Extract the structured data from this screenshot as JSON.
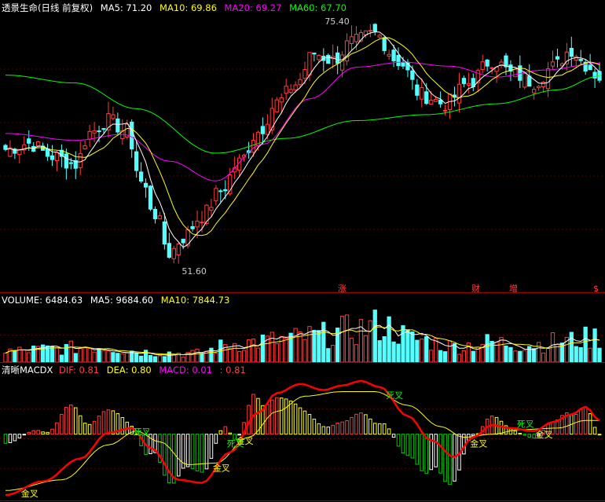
{
  "main": {
    "title": "透景生命(日线 前复权)",
    "ma5_label": "MA5: 71.20",
    "ma10_label": "MA10: 69.86",
    "ma20_label": "MA20: 69.27",
    "ma60_label": "MA60: 67.70",
    "high_label": "75.40",
    "low_label": "51.60",
    "event_markers": [
      "涨",
      "财",
      "增",
      "$"
    ]
  },
  "volume": {
    "label": "VOLUME: 6484.63",
    "ma5_label": "MA5: 9684.60",
    "ma10_label": "MA10: 7844.73"
  },
  "macd": {
    "name": "清晰MACDX",
    "dif_label": "DIF: 0.81",
    "dea_label": "DEA: 0.80",
    "macd_label": "MACD: 0.01",
    "extra_label": ": 0.81",
    "cross_labels": [
      "金叉",
      "死叉",
      "金叉",
      "死叉",
      "金叉",
      "死叉",
      "金叉",
      "死叉",
      "金叉"
    ]
  },
  "colors": {
    "up": "#ff3c3c",
    "down": "#54ffff",
    "ma5": "#ffffff",
    "ma10": "#ffff00",
    "ma20": "#ff00ff",
    "ma60": "#00ff00",
    "dif": "#ff0000",
    "dea": "#ffff00"
  },
  "chart_data": {
    "type": "candlestick",
    "x_count": 128,
    "price_range": [
      50,
      77
    ],
    "volume_range": [
      0,
      30000
    ],
    "macd_range": [
      -4.2,
      3.6
    ],
    "grid": true,
    "anchors_close": [
      [
        0,
        63.5
      ],
      [
        5,
        64.1
      ],
      [
        10,
        62.8
      ],
      [
        15,
        62.0
      ],
      [
        18,
        65.2
      ],
      [
        22,
        66.4
      ],
      [
        26,
        65.3
      ],
      [
        29,
        60.2
      ],
      [
        32,
        57.0
      ],
      [
        35,
        53.0
      ],
      [
        38,
        54.6
      ],
      [
        42,
        56.8
      ],
      [
        46,
        59.3
      ],
      [
        50,
        62.2
      ],
      [
        54,
        65.3
      ],
      [
        58,
        68.2
      ],
      [
        62,
        70.1
      ],
      [
        66,
        73.2
      ],
      [
        70,
        72.5
      ],
      [
        74,
        74.3
      ],
      [
        79,
        75.2
      ],
      [
        84,
        72.4
      ],
      [
        89,
        69.0
      ],
      [
        94,
        68.1
      ],
      [
        99,
        70.2
      ],
      [
        104,
        72.5
      ],
      [
        109,
        71.0
      ],
      [
        113,
        70.3
      ],
      [
        117,
        71.8
      ],
      [
        121,
        73.6
      ],
      [
        124,
        72.1
      ],
      [
        127,
        70.8
      ]
    ],
    "ma60_anchors": [
      [
        0,
        71.0
      ],
      [
        15,
        70.2
      ],
      [
        28,
        67.6
      ],
      [
        45,
        63.1
      ],
      [
        60,
        64.6
      ],
      [
        75,
        66.4
      ],
      [
        90,
        67.0
      ],
      [
        105,
        68.1
      ],
      [
        118,
        69.5
      ],
      [
        127,
        70.9
      ]
    ],
    "ma20_anchors": [
      [
        0,
        65.1
      ],
      [
        15,
        64.4
      ],
      [
        25,
        65.0
      ],
      [
        35,
        62.3
      ],
      [
        45,
        60.3
      ],
      [
        55,
        64.0
      ],
      [
        65,
        68.6
      ],
      [
        75,
        71.8
      ],
      [
        85,
        72.3
      ],
      [
        95,
        71.9
      ],
      [
        105,
        70.8
      ],
      [
        115,
        71.5
      ],
      [
        127,
        72.2
      ]
    ],
    "volume_anchors": [
      [
        0,
        6500
      ],
      [
        10,
        7800
      ],
      [
        20,
        9500
      ],
      [
        30,
        6000
      ],
      [
        40,
        5200
      ],
      [
        50,
        11500
      ],
      [
        58,
        13000
      ],
      [
        66,
        15500
      ],
      [
        74,
        19000
      ],
      [
        80,
        22000
      ],
      [
        88,
        13500
      ],
      [
        96,
        9500
      ],
      [
        104,
        11800
      ],
      [
        112,
        10500
      ],
      [
        120,
        12800
      ],
      [
        127,
        15000
      ]
    ],
    "dif_anchors": [
      [
        0,
        -4.0
      ],
      [
        8,
        -3.1
      ],
      [
        16,
        -1.6
      ],
      [
        22,
        0.1
      ],
      [
        27,
        0.4
      ],
      [
        31,
        -0.9
      ],
      [
        37,
        -3.0
      ],
      [
        42,
        -3.2
      ],
      [
        48,
        -1.2
      ],
      [
        54,
        1.4
      ],
      [
        58,
        2.7
      ],
      [
        63,
        3.3
      ],
      [
        68,
        2.9
      ],
      [
        72,
        3.2
      ],
      [
        76,
        3.5
      ],
      [
        80,
        3.1
      ],
      [
        86,
        1.2
      ],
      [
        91,
        -0.4
      ],
      [
        96,
        -1.5
      ],
      [
        100,
        -0.2
      ],
      [
        104,
        0.6
      ],
      [
        108,
        0.4
      ],
      [
        113,
        0.2
      ],
      [
        117,
        0.8
      ],
      [
        121,
        1.3
      ],
      [
        124,
        1.8
      ],
      [
        127,
        0.9
      ]
    ],
    "dea_anchors": [
      [
        0,
        -3.7
      ],
      [
        12,
        -3.0
      ],
      [
        22,
        -0.7
      ],
      [
        28,
        0.2
      ],
      [
        33,
        -0.5
      ],
      [
        39,
        -2.0
      ],
      [
        45,
        -1.9
      ],
      [
        52,
        -0.2
      ],
      [
        58,
        1.5
      ],
      [
        64,
        2.5
      ],
      [
        72,
        2.8
      ],
      [
        79,
        2.8
      ],
      [
        86,
        1.9
      ],
      [
        93,
        0.5
      ],
      [
        98,
        -0.2
      ],
      [
        104,
        0.0
      ],
      [
        110,
        0.3
      ],
      [
        118,
        0.4
      ],
      [
        124,
        0.9
      ],
      [
        127,
        0.9
      ]
    ]
  }
}
